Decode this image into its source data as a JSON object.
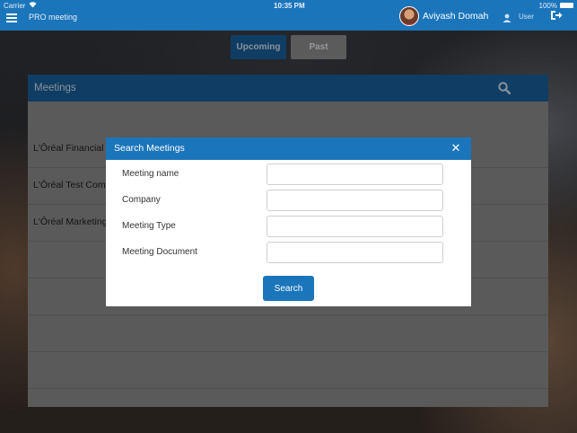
{
  "status_bar": {
    "carrier": "Carrier",
    "time": "10:35 PM",
    "battery": "100%"
  },
  "header": {
    "app_title": "PRO meeting",
    "user_name": "Aviyash Domah",
    "user_label": "User"
  },
  "tabs": [
    {
      "label": "Upcoming"
    },
    {
      "label": "Past"
    }
  ],
  "meetings_panel": {
    "title": "Meetings",
    "items": [
      {
        "label": "L'Ôréal Financial"
      },
      {
        "label": "L'Ôréal Test Com"
      },
      {
        "label": "L'Ôréal Marketing"
      },
      {
        "label": ""
      },
      {
        "label": ""
      },
      {
        "label": ""
      },
      {
        "label": ""
      },
      {
        "label": ""
      }
    ]
  },
  "search_modal": {
    "title": "Search Meetings",
    "fields": [
      {
        "label": "Meeting name",
        "value": "",
        "placeholder": ""
      },
      {
        "label": "Company",
        "value": "",
        "placeholder": ""
      },
      {
        "label": "Meeting Type",
        "value": "",
        "placeholder": ""
      },
      {
        "label": "Meeting Document",
        "value": "",
        "placeholder": ""
      }
    ],
    "search_label": "Search"
  },
  "colors": {
    "primary": "#1b75bb",
    "primary_dark": "#1a5f99",
    "inactive_tab": "#8d8d8d"
  },
  "icons": {
    "menu": "menu-icon",
    "user": "user-icon",
    "logout": "logout-icon",
    "search": "search-icon",
    "close": "close-icon",
    "wifi": "wifi-icon",
    "battery": "battery-icon"
  }
}
